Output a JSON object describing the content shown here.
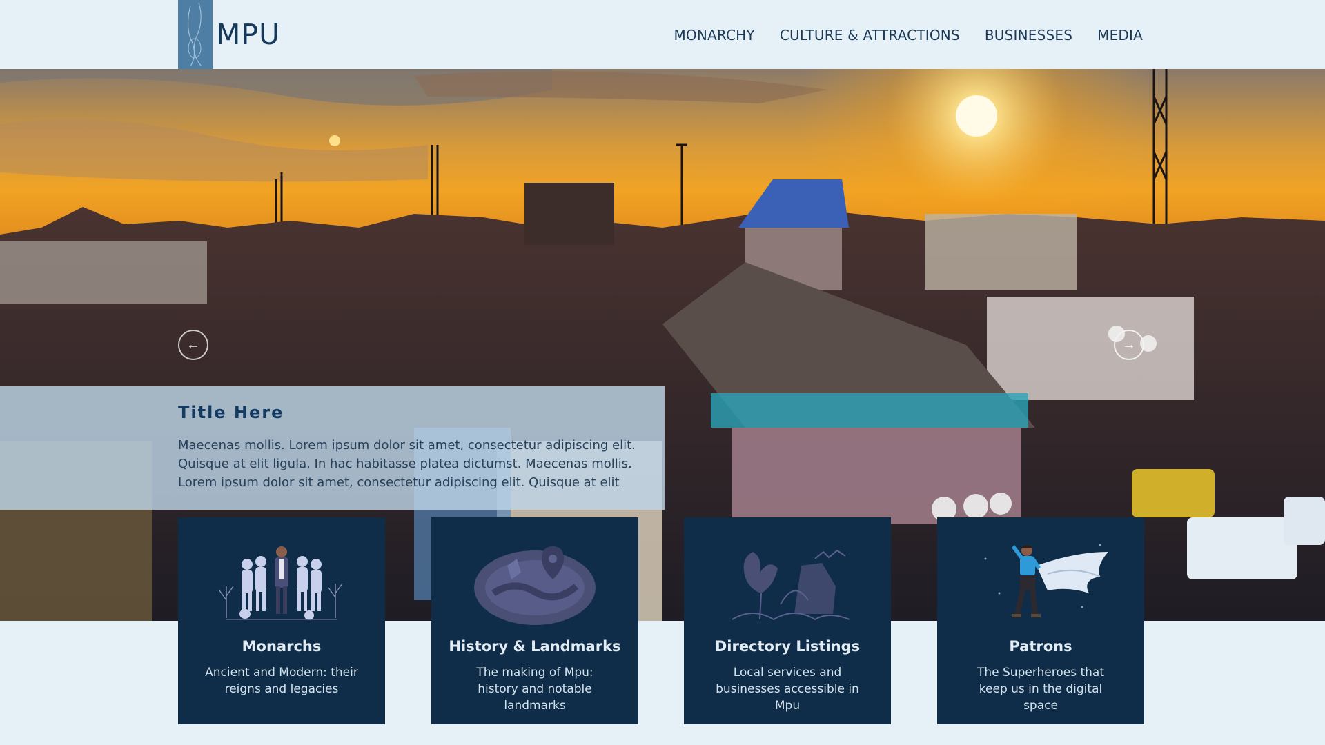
{
  "header": {
    "logo_text": "MPU",
    "nav": [
      "MONARCHY",
      "CULTURE & ATTRACTIONS",
      "BUSINESSES",
      "MEDIA"
    ]
  },
  "hero": {
    "caption_title": "Title Here",
    "caption_text": "Maecenas mollis. Lorem ipsum dolor sit amet, consectetur adipiscing elit. Quisque at elit ligula. In hac habitasse platea dictumst. Maecenas mollis. Lorem ipsum dolor sit amet, consectetur adipiscing elit. Quisque at elit",
    "prev_icon": "arrow-left-icon",
    "next_icon": "arrow-right-icon"
  },
  "cards": [
    {
      "title": "Monarchs",
      "description": "Ancient and Modern: their reigns and legacies",
      "icon": "people-group-icon"
    },
    {
      "title": "History & Landmarks",
      "description": "The making of Mpu: history and notable landmarks",
      "icon": "map-location-icon"
    },
    {
      "title": "Directory Listings",
      "description": "Local services and businesses accessible in Mpu",
      "icon": "landscape-icon"
    },
    {
      "title": "Patrons",
      "description": "The Superheroes that keep us in the digital space",
      "icon": "superhero-icon"
    }
  ],
  "colors": {
    "background": "#e6f0f7",
    "brand_dark": "#0f2d48",
    "logo_blue": "#4e7ea3",
    "caption_overlay": "#bed6e8"
  }
}
